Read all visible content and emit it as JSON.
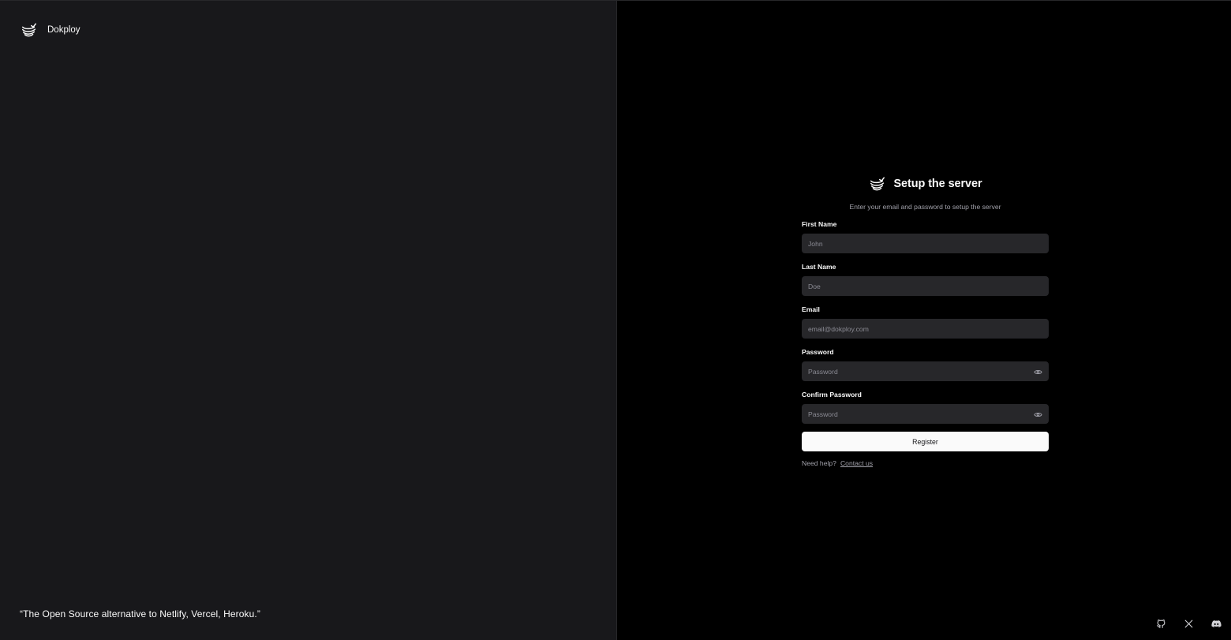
{
  "left": {
    "brand_name": "Dokploy",
    "tagline": "“The Open Source alternative to Netlify, Vercel, Heroku.”"
  },
  "form": {
    "title": "Setup the server",
    "subtitle": "Enter your email and password to setup the server",
    "fields": [
      {
        "label": "First Name",
        "placeholder": "John",
        "value": ""
      },
      {
        "label": "Last Name",
        "placeholder": "Doe",
        "value": ""
      },
      {
        "label": "Email",
        "placeholder": "email@dokploy.com",
        "value": ""
      },
      {
        "label": "Password",
        "placeholder": "Password",
        "value": ""
      },
      {
        "label": "Confirm Password",
        "placeholder": "Password",
        "value": ""
      }
    ],
    "register_label": "Register",
    "help_text": "Need help?",
    "help_link": "Contact us"
  },
  "icons": {
    "logo": "dokploy-logo-icon",
    "password_toggle": "eye-icon",
    "socials": [
      "github-icon",
      "x-icon",
      "discord-icon"
    ]
  },
  "colors": {
    "left_bg": "#18181b",
    "right_bg": "#000000",
    "input_bg": "#27272a",
    "button_bg": "#fafafa",
    "muted_text": "#a1a1aa"
  }
}
